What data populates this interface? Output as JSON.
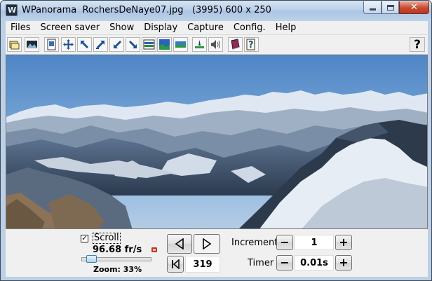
{
  "window": {
    "title": "WPanorama  RochersDeNaye07.jpg   (3995) 600 x 250",
    "icon": "app-icon",
    "close_glyph": "✕"
  },
  "menu": [
    "Files",
    "Screen saver",
    "Show",
    "Display",
    "Capture",
    "Config.",
    "Help"
  ],
  "toolbar": {
    "buttons": [
      "open-file-icon",
      "picture-icon",
      "page-icon",
      "move-icon",
      "zoom-in-icon",
      "expand-ne-icon",
      "shrink-icon",
      "expand-se-icon",
      "horizon-icon",
      "landscape-icon",
      "scene-icon",
      "tripod-icon",
      "sound-icon",
      "book-icon",
      "help-document-icon"
    ],
    "help_label": "?"
  },
  "controls": {
    "scroll_label": "Scroll",
    "scroll_checked": true,
    "check_mark": "✓",
    "fps": "96.68 fr/s",
    "zoom": "Zoom: 33%",
    "zoom_percent": 33,
    "position": "319",
    "increment_label": "Increment",
    "increment_value": "1",
    "timer_label": "Timer",
    "timer_value": "0.01s",
    "minus": "−",
    "plus": "+"
  }
}
